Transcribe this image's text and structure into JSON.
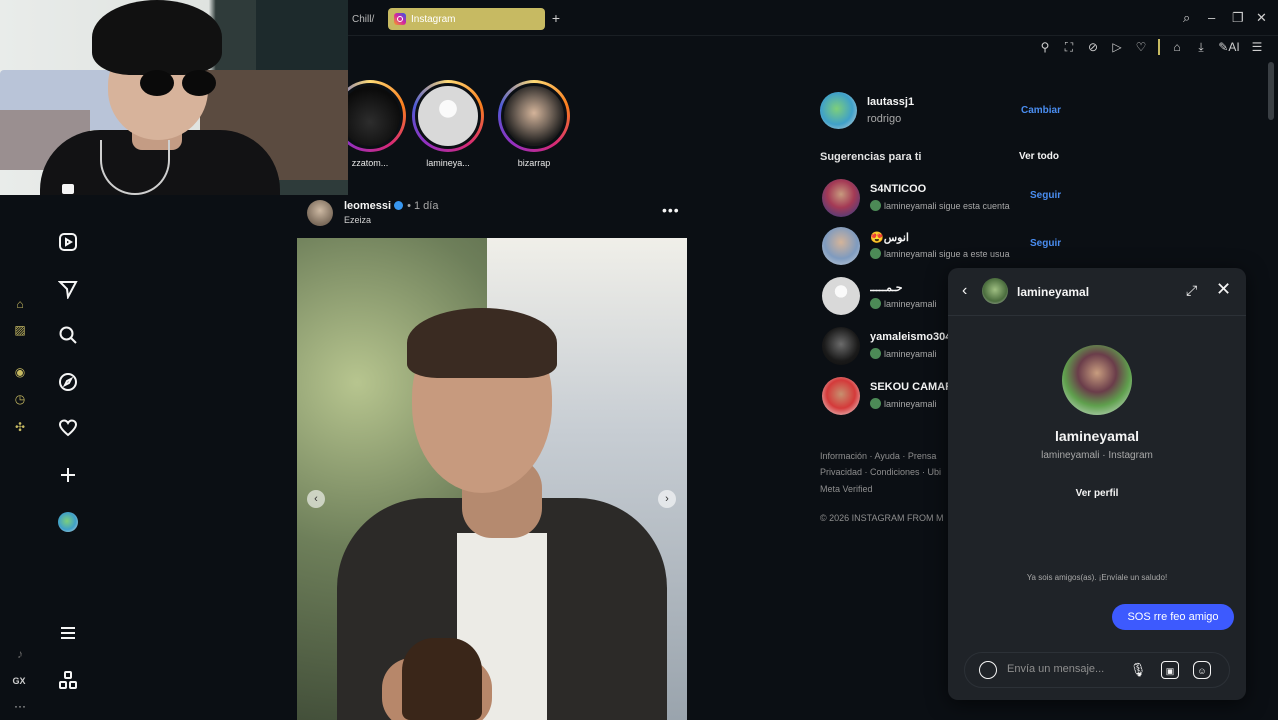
{
  "browser": {
    "tabs": [
      {
        "label": "Chill/"
      },
      {
        "label": "Instagram"
      }
    ],
    "new_tab": "+"
  },
  "stories": [
    {
      "name": "zzatom..."
    },
    {
      "name": "lamineya..."
    },
    {
      "name": "bizarrap"
    }
  ],
  "post": {
    "user": "leomessi",
    "time": "• 1 día",
    "location": "Ezeiza",
    "more": "•••"
  },
  "account": {
    "username": "lautassj1",
    "name": "rodrigo",
    "switch_label": "Cambiar"
  },
  "suggestions": {
    "title": "Sugerencias para ti",
    "see_all": "Ver todo",
    "items": [
      {
        "name": "S4NTICOO",
        "sub": "lamineyamali sigue esta cuenta",
        "follow": "Seguir"
      },
      {
        "name": "😍انوس",
        "sub": "lamineyamali sigue a este usua",
        "follow": "Seguir"
      },
      {
        "name": "حـمـــــ",
        "sub": "lamineyamali",
        "follow": ""
      },
      {
        "name": "yamaleismo304",
        "sub": "lamineyamali",
        "follow": ""
      },
      {
        "name": "SEKOU CAMARA",
        "sub": "lamineyamali",
        "follow": ""
      }
    ]
  },
  "footer": {
    "line1": "Información · Ayuda · Prensa",
    "line2": "Privacidad · Condiciones · Ubi",
    "line3": "Meta Verified",
    "copyright": "© 2026 INSTAGRAM FROM M"
  },
  "chat": {
    "header_name": "lamineyamal",
    "profile_name": "lamineyamal",
    "profile_sub": "lamineyamali · Instagram",
    "view_profile": "Ver perfil",
    "friends_note": "Ya sois amigos(as). ¡Envíale un saludo!",
    "message": "SOS rre feo amigo",
    "input_placeholder": "Envía un mensaje..."
  },
  "sidebar_bottom_label": "GX",
  "colors": {
    "accent": "#c7ba62",
    "link": "#4a8df0",
    "bubble": "#3d5afe",
    "background": "#0b0f14",
    "chat_panel": "#1f2328"
  }
}
